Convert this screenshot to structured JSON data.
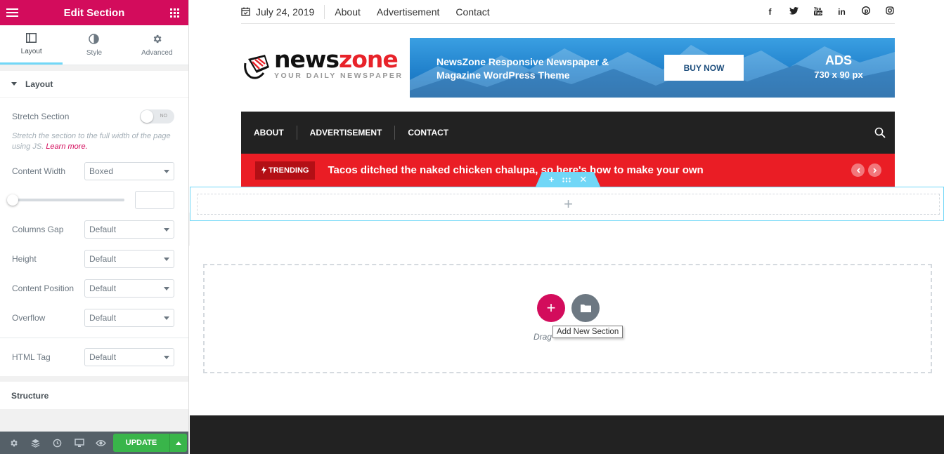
{
  "panel": {
    "title": "Edit Section",
    "tabs": [
      {
        "label": "Layout",
        "icon": "layout-icon",
        "active": true
      },
      {
        "label": "Style",
        "icon": "style-icon"
      },
      {
        "label": "Advanced",
        "icon": "gear-icon"
      }
    ],
    "layout_section": {
      "title": "Layout",
      "stretch_label": "Stretch Section",
      "stretch_toggle": "NO",
      "stretch_desc": "Stretch the section to the full width of the page using JS.",
      "learn_more": "Learn more.",
      "content_width_label": "Content Width",
      "content_width_value": "Boxed",
      "columns_gap_label": "Columns Gap",
      "columns_gap_value": "Default",
      "height_label": "Height",
      "height_value": "Default",
      "content_position_label": "Content Position",
      "content_position_value": "Default",
      "overflow_label": "Overflow",
      "overflow_value": "Default",
      "html_tag_label": "HTML Tag",
      "html_tag_value": "Default"
    },
    "structure_title": "Structure",
    "footer": {
      "update_label": "UPDATE"
    }
  },
  "site": {
    "topbar": {
      "date": "July 24, 2019",
      "links": [
        "About",
        "Advertisement",
        "Contact"
      ]
    },
    "logo": {
      "word1": "news",
      "word2": "zone",
      "tagline": "YOUR DAILY NEWSPAPER"
    },
    "banner": {
      "line1": "NewsZone Responsive Newspaper &",
      "line2": "Magazine WordPress Theme",
      "button": "BUY NOW",
      "ads": "ADS",
      "size": "730 x 90 px"
    },
    "nav": [
      "ABOUT",
      "ADVERTISEMENT",
      "CONTACT"
    ],
    "trending": {
      "badge": "TRENDING",
      "headline": "Tacos ditched the naked chicken chalupa, so here's how to make your own"
    }
  },
  "editor": {
    "drag_text": "Drag",
    "tooltip": "Add New Section"
  },
  "colors": {
    "brand": "#d30c5c",
    "accent": "#71d7f7",
    "update": "#39b54a",
    "trending": "#ea1d25"
  }
}
